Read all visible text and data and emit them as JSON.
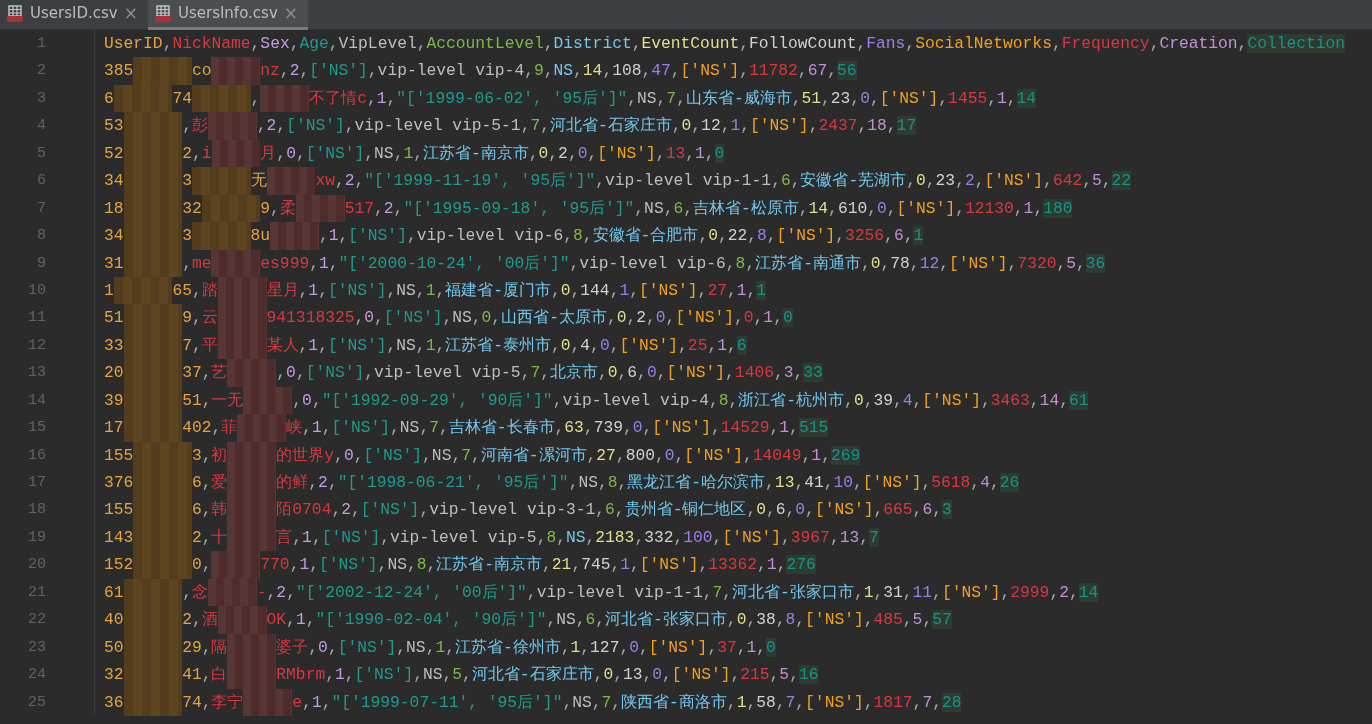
{
  "tabs": [
    {
      "label": "UsersID.csv",
      "close": "×",
      "selected": false
    },
    {
      "label": "UsersInfo.csv",
      "close": "×",
      "selected": true
    }
  ],
  "delimiter": ",",
  "header": {
    "line": "1",
    "columns": [
      {
        "name": "UserID",
        "color": "#e8a33d",
        "highlighted": false
      },
      {
        "name": "NickName",
        "color": "#d8383f",
        "highlighted": false
      },
      {
        "name": "Sex",
        "color": "#c49be6",
        "highlighted": false
      },
      {
        "name": "Age",
        "color": "#1e9a8f",
        "highlighted": false
      },
      {
        "name": "VipLevel",
        "color": "#bcbec4",
        "highlighted": false
      },
      {
        "name": "AccountLevel",
        "color": "#7cba48",
        "highlighted": false
      },
      {
        "name": "District",
        "color": "#72c8ee",
        "highlighted": false
      },
      {
        "name": "EventCount",
        "color": "#e6df8c",
        "highlighted": false
      },
      {
        "name": "FollowCount",
        "color": "#cfd1d4",
        "highlighted": false
      },
      {
        "name": "Fans",
        "color": "#9e7de8",
        "highlighted": false
      },
      {
        "name": "SocialNetworks",
        "color": "#f2a11e",
        "highlighted": false
      },
      {
        "name": "Frequency",
        "color": "#d8383f",
        "highlighted": false
      },
      {
        "name": "Creation",
        "color": "#c38fd6",
        "highlighted": false
      },
      {
        "name": "Collection",
        "color": "#15948a",
        "highlighted": true
      }
    ]
  },
  "rows": [
    {
      "line": "2",
      "head": [
        "385",
        {
          "kind": "hidden_id"
        },
        "co",
        {
          "kind": "hidden_name"
        },
        "nz"
      ],
      "cells": [
        "2",
        "['NS']",
        "vip-level vip-4",
        "9",
        "NS",
        "14",
        "108",
        "47",
        "['NS']",
        "11782",
        "67",
        "56"
      ]
    },
    {
      "line": "3",
      "head": [
        "6",
        {
          "kind": "hidden_id"
        },
        "74",
        {
          "kind": "hidden_id"
        },
        ",",
        {
          "kind": "hidden_name"
        },
        "不了情c"
      ],
      "cells": [
        "1",
        "\"['1999-06-02', '95后']\"",
        "NS",
        "7",
        "山东省-威海市",
        "51",
        "23",
        "0",
        "['NS']",
        "1455",
        "1",
        "14"
      ]
    },
    {
      "line": "4",
      "head": [
        "53",
        {
          "kind": "hidden_id"
        },
        ",彭",
        {
          "kind": "hidden_name"
        }
      ],
      "cells": [
        "2",
        "['NS']",
        "vip-level vip-5-1",
        "7",
        "河北省-石家庄市",
        "0",
        "12",
        "1",
        "['NS']",
        "2437",
        "18",
        "17"
      ]
    },
    {
      "line": "5",
      "head": [
        "52",
        {
          "kind": "hidden_id"
        },
        "2,i",
        {
          "kind": "hidden_name"
        },
        "月"
      ],
      "cells": [
        "0",
        "['NS']",
        "NS",
        "1",
        "江苏省-南京市",
        "0",
        "2",
        "0",
        "['NS']",
        "13",
        "1",
        "0"
      ]
    },
    {
      "line": "6",
      "head": [
        "34",
        {
          "kind": "hidden_id"
        },
        "3",
        {
          "kind": "hidden_id"
        },
        "无",
        {
          "kind": "hidden_name"
        },
        "xw"
      ],
      "cells": [
        "2",
        "\"['1999-11-19', '95后']\"",
        "vip-level vip-1-1",
        "6",
        "安徽省-芜湖市",
        "0",
        "23",
        "2",
        "['NS']",
        "642",
        "5",
        "22"
      ]
    },
    {
      "line": "7",
      "head": [
        "18",
        {
          "kind": "hidden_id"
        },
        "32",
        {
          "kind": "hidden_id"
        },
        "9,柔",
        {
          "kind": "hidden_name"
        },
        "517"
      ],
      "cells": [
        "2",
        "\"['1995-09-18', '95后']\"",
        "NS",
        "6",
        "吉林省-松原市",
        "14",
        "610",
        "0",
        "['NS']",
        "12130",
        "1",
        "180"
      ]
    },
    {
      "line": "8",
      "head": [
        "34",
        {
          "kind": "hidden_id"
        },
        "3",
        {
          "kind": "hidden_id"
        },
        "8u",
        {
          "kind": "hidden_name"
        }
      ],
      "cells": [
        "1",
        "['NS']",
        "vip-level vip-6",
        "8",
        "安徽省-合肥市",
        "0",
        "22",
        "8",
        "['NS']",
        "3256",
        "6",
        "1"
      ]
    },
    {
      "line": "9",
      "head": [
        "31",
        {
          "kind": "hidden_id"
        },
        ",me",
        {
          "kind": "hidden_name"
        },
        "es999"
      ],
      "cells": [
        "1",
        "\"['2000-10-24', '00后']\"",
        "vip-level vip-6",
        "8",
        "江苏省-南通市",
        "0",
        "78",
        "12",
        "['NS']",
        "7320",
        "5",
        "36"
      ]
    },
    {
      "line": "10",
      "head": [
        "1",
        {
          "kind": "hidden_id"
        },
        "65,踏",
        {
          "kind": "hidden_name"
        },
        "星月"
      ],
      "cells": [
        "1",
        "['NS']",
        "NS",
        "1",
        "福建省-厦门市",
        "0",
        "144",
        "1",
        "['NS']",
        "27",
        "1",
        "1"
      ]
    },
    {
      "line": "11",
      "head": [
        "51",
        {
          "kind": "hidden_id"
        },
        "9,云",
        {
          "kind": "hidden_name"
        },
        "941318325"
      ],
      "cells": [
        "0",
        "['NS']",
        "NS",
        "0",
        "山西省-太原市",
        "0",
        "2",
        "0",
        "['NS']",
        "0",
        "1",
        "0"
      ]
    },
    {
      "line": "12",
      "head": [
        "33",
        {
          "kind": "hidden_id"
        },
        "7,平",
        {
          "kind": "hidden_name"
        },
        "某人"
      ],
      "cells": [
        "1",
        "['NS']",
        "NS",
        "1",
        "江苏省-泰州市",
        "0",
        "4",
        "0",
        "['NS']",
        "25",
        "1",
        "6"
      ]
    },
    {
      "line": "13",
      "head": [
        "20",
        {
          "kind": "hidden_id"
        },
        "37,艺",
        {
          "kind": "hidden_name"
        }
      ],
      "cells": [
        "0",
        "['NS']",
        "vip-level vip-5",
        "7",
        "北京市",
        "0",
        "6",
        "0",
        "['NS']",
        "1406",
        "3",
        "33"
      ]
    },
    {
      "line": "14",
      "head": [
        "39",
        {
          "kind": "hidden_id"
        },
        "51,一无",
        {
          "kind": "hidden_name"
        }
      ],
      "cells": [
        "0",
        "\"['1992-09-29', '90后']\"",
        "vip-level vip-4",
        "8",
        "浙江省-杭州市",
        "0",
        "39",
        "4",
        "['NS']",
        "3463",
        "14",
        "61"
      ]
    },
    {
      "line": "15",
      "head": [
        "17",
        {
          "kind": "hidden_id"
        },
        "402,菲",
        {
          "kind": "hidden_name"
        },
        "峡"
      ],
      "cells": [
        "1",
        "['NS']",
        "NS",
        "7",
        "吉林省-长春市",
        "63",
        "739",
        "0",
        "['NS']",
        "14529",
        "1",
        "515"
      ]
    },
    {
      "line": "16",
      "head": [
        "155",
        {
          "kind": "hidden_id"
        },
        "3,初",
        {
          "kind": "hidden_name"
        },
        "的世界y"
      ],
      "cells": [
        "0",
        "['NS']",
        "NS",
        "7",
        "河南省-漯河市",
        "27",
        "800",
        "0",
        "['NS']",
        "14049",
        "1",
        "269"
      ]
    },
    {
      "line": "17",
      "head": [
        "376",
        {
          "kind": "hidden_id"
        },
        "6,爱",
        {
          "kind": "hidden_name"
        },
        "的鲜"
      ],
      "cells": [
        "2",
        "\"['1998-06-21', '95后']\"",
        "NS",
        "8",
        "黑龙江省-哈尔滨市",
        "13",
        "41",
        "10",
        "['NS']",
        "5618",
        "4",
        "26"
      ]
    },
    {
      "line": "18",
      "head": [
        "155",
        {
          "kind": "hidden_id"
        },
        "6,韩",
        {
          "kind": "hidden_name"
        },
        "陌0704"
      ],
      "cells": [
        "2",
        "['NS']",
        "vip-level vip-3-1",
        "6",
        "贵州省-铜仁地区",
        "0",
        "6",
        "0",
        "['NS']",
        "665",
        "6",
        "3"
      ]
    },
    {
      "line": "19",
      "head": [
        "143",
        {
          "kind": "hidden_id"
        },
        "2,十",
        {
          "kind": "hidden_name"
        },
        "言"
      ],
      "cells": [
        "1",
        "['NS']",
        "vip-level vip-5",
        "8",
        "NS",
        "2183",
        "332",
        "100",
        "['NS']",
        "3967",
        "13",
        "7"
      ]
    },
    {
      "line": "20",
      "head": [
        "152",
        {
          "kind": "hidden_id"
        },
        "0,",
        {
          "kind": "hidden_name"
        },
        "770"
      ],
      "cells": [
        "1",
        "['NS']",
        "NS",
        "8",
        "江苏省-南京市",
        "21",
        "745",
        "1",
        "['NS']",
        "13362",
        "1",
        "276"
      ]
    },
    {
      "line": "21",
      "head": [
        "61",
        {
          "kind": "hidden_id"
        },
        ",念",
        {
          "kind": "hidden_name"
        },
        "-"
      ],
      "cells": [
        "2",
        "\"['2002-12-24', '00后']\"",
        "vip-level vip-1-1",
        "7",
        "河北省-张家口市",
        "1",
        "31",
        "11",
        "['NS']",
        "2999",
        "2",
        "14"
      ]
    },
    {
      "line": "22",
      "head": [
        "40",
        {
          "kind": "hidden_id"
        },
        "2,酒",
        {
          "kind": "hidden_name"
        },
        "OK"
      ],
      "cells": [
        "1",
        "\"['1990-02-04', '90后']\"",
        "NS",
        "6",
        "河北省-张家口市",
        "0",
        "38",
        "8",
        "['NS']",
        "485",
        "5",
        "57"
      ]
    },
    {
      "line": "23",
      "head": [
        "50",
        {
          "kind": "hidden_id"
        },
        "29,隔",
        {
          "kind": "hidden_name"
        },
        "婆子"
      ],
      "cells": [
        "0",
        "['NS']",
        "NS",
        "1",
        "江苏省-徐州市",
        "1",
        "127",
        "0",
        "['NS']",
        "37",
        "1",
        "0"
      ]
    },
    {
      "line": "24",
      "head": [
        "32",
        {
          "kind": "hidden_id"
        },
        "41,白",
        {
          "kind": "hidden_name"
        },
        "RMbrm"
      ],
      "cells": [
        "1",
        "['NS']",
        "NS",
        "5",
        "河北省-石家庄市",
        "0",
        "13",
        "0",
        "['NS']",
        "215",
        "5",
        "16"
      ]
    },
    {
      "line": "25",
      "head": [
        "36",
        {
          "kind": "hidden_id"
        },
        "74,李宁",
        {
          "kind": "hidden_name"
        },
        "e"
      ],
      "cells": [
        "1",
        "\"['1999-07-11', '95后']\"",
        "NS",
        "7",
        "陕西省-商洛市",
        "1",
        "58",
        "7",
        "['NS']",
        "1817",
        "7",
        "28"
      ]
    }
  ]
}
